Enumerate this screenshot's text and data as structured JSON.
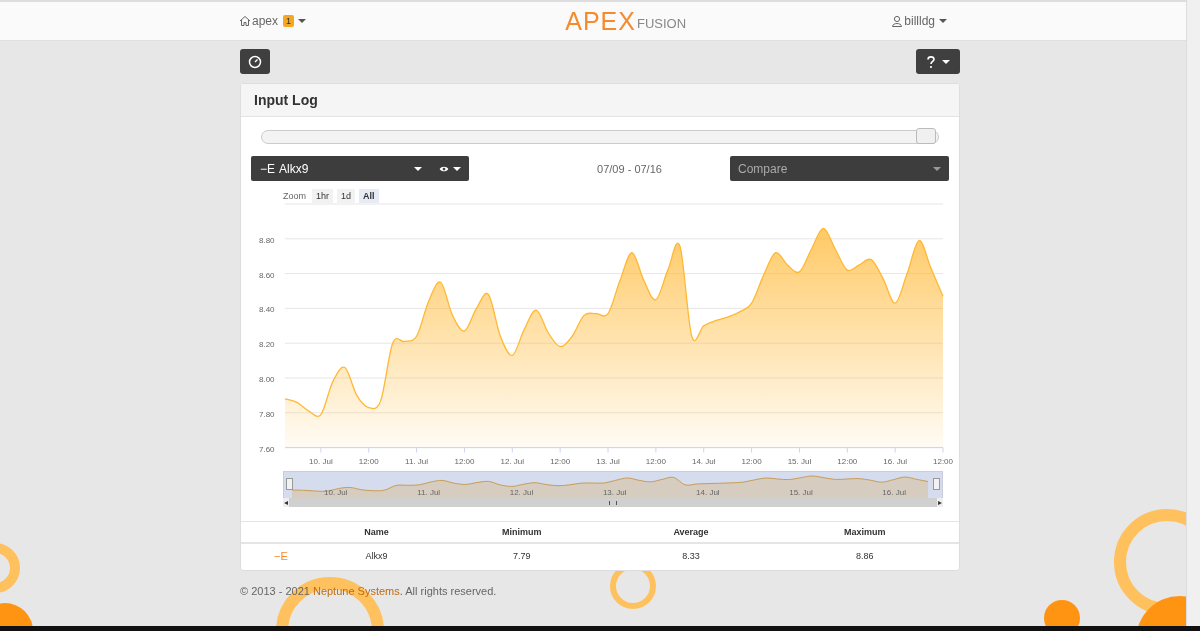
{
  "navbar": {
    "home": "apex",
    "badge": "1",
    "logo_main": "APEX",
    "logo_sub": "FUSION",
    "user": "billldg"
  },
  "card": {
    "title": "Input Log",
    "range_slider": {
      "level": 1
    },
    "input_select": {
      "icon": "−E",
      "value": "Alkx9"
    },
    "date_range": "07/09 - 07/16",
    "compare": {
      "placeholder": "Compare"
    },
    "zoom": {
      "label": "Zoom",
      "buttons": [
        {
          "label": "1hr",
          "selected": false
        },
        {
          "label": "1d",
          "selected": false
        },
        {
          "label": "All",
          "selected": true
        }
      ]
    },
    "chart_data": {
      "type": "area",
      "grid": true,
      "ylim": [
        7.6,
        9.0
      ],
      "yticks": [
        {
          "value": 7.6,
          "label": "7.60"
        },
        {
          "value": 7.8,
          "label": "7.80"
        },
        {
          "value": 8.0,
          "label": "8.00"
        },
        {
          "value": 8.2,
          "label": "8.20"
        },
        {
          "value": 8.4,
          "label": "8.40"
        },
        {
          "value": 8.6,
          "label": "8.60"
        },
        {
          "value": 8.8,
          "label": "8.80"
        }
      ],
      "categories": [
        null,
        null,
        null,
        "10. Jul",
        null,
        null,
        null,
        "12:00",
        null,
        null,
        null,
        "11. Jul",
        null,
        null,
        null,
        "12:00",
        null,
        null,
        null,
        "12. Jul",
        null,
        null,
        null,
        "12:00",
        null,
        null,
        null,
        "13. Jul",
        null,
        null,
        null,
        "12:00",
        null,
        null,
        null,
        "14. Jul",
        null,
        null,
        null,
        "12:00",
        null,
        null,
        null,
        "15. Jul",
        null,
        null,
        null,
        "12:00",
        null,
        null,
        null,
        "16. Jul",
        null,
        null,
        null,
        "12:00"
      ],
      "series": [
        {
          "color": "#ffb833",
          "values": [
            7.88,
            7.86,
            7.81,
            7.79,
            7.98,
            8.06,
            7.9,
            7.83,
            7.87,
            8.2,
            8.21,
            8.24,
            8.44,
            8.55,
            8.36,
            8.27,
            8.4,
            8.48,
            8.24,
            8.13,
            8.28,
            8.39,
            8.26,
            8.18,
            8.24,
            8.36,
            8.37,
            8.37,
            8.56,
            8.72,
            8.56,
            8.45,
            8.62,
            8.76,
            8.24,
            8.3,
            8.33,
            8.35,
            8.38,
            8.43,
            8.59,
            8.72,
            8.65,
            8.61,
            8.74,
            8.86,
            8.74,
            8.62,
            8.65,
            8.68,
            8.57,
            8.43,
            8.6,
            8.79,
            8.63,
            8.47
          ]
        }
      ]
    },
    "navigator": {
      "left_arrow": "◂",
      "right_arrow": "▸",
      "labels": [
        "10. Jul",
        "11. Jul",
        "12. Jul",
        "13. Jul",
        "14. Jul",
        "15. Jul",
        "16. Jul"
      ]
    },
    "table": {
      "columns": [
        "Name",
        "Minimum",
        "Average",
        "Maximum"
      ],
      "rows": [
        {
          "icon": "−E",
          "name": "Alkx9",
          "minimum": "7.79",
          "average": "8.33",
          "maximum": "8.86"
        }
      ]
    }
  },
  "footer": {
    "prefix": "© 2013 - 2021 ",
    "link": "Neptune Systems",
    "suffix": ". All rights reserved."
  }
}
